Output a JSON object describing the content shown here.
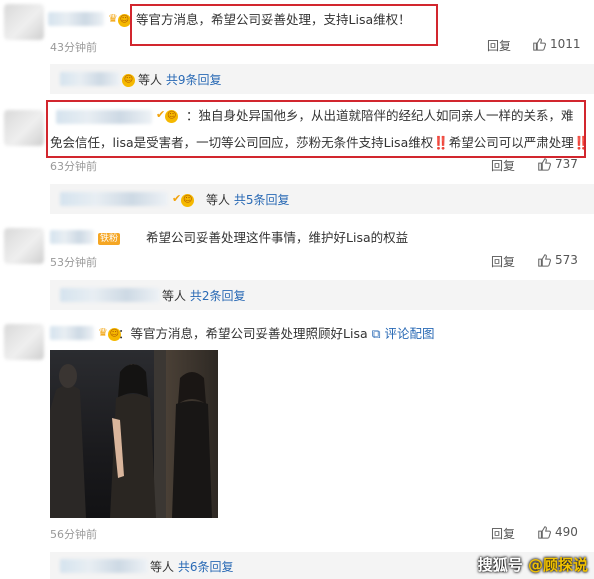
{
  "comments": [
    {
      "text": "等官方消息，希望公司妥善处理，支持Lisa维权！",
      "time": "43分钟前",
      "reply": "回复",
      "likes": "1011",
      "sub": {
        "label": "等人",
        "more": "共9条回复"
      }
    },
    {
      "text_line1": "：独自身处异国他乡，从出道就陪伴的经纪人如同亲人一样的关系，难",
      "text_line2": "免会信任，lisa是受害者，一切等公司回应，莎粉无条件支持Lisa维权‼️希望公司可以严肃处理‼️",
      "time": "63分钟前",
      "reply": "回复",
      "likes": "737",
      "sub": {
        "label": "等人",
        "more": "共5条回复"
      }
    },
    {
      "badge": "铁粉",
      "text": "希望公司妥善处理这件事情，维护好Lisa的权益",
      "time": "53分钟前",
      "reply": "回复",
      "likes": "573",
      "sub": {
        "label": "等人",
        "more": "共2条回复"
      }
    },
    {
      "text": "：等官方消息，希望公司妥善处理照顾好Lisa",
      "link": "评论配图",
      "time": "56分钟前",
      "reply": "回复",
      "likes": "490",
      "sub": {
        "label": "等人",
        "more": "共6条回复"
      }
    }
  ],
  "watermark": {
    "left": "搜狐号",
    "right": "@顾探说"
  },
  "colors": {
    "link": "#2a6ab5",
    "highlight_box": "#d2262e",
    "crown": "#f2a20a"
  },
  "icons": [
    "crown-icon",
    "smile-badge-icon",
    "thumb-up-icon",
    "picture-icon"
  ]
}
